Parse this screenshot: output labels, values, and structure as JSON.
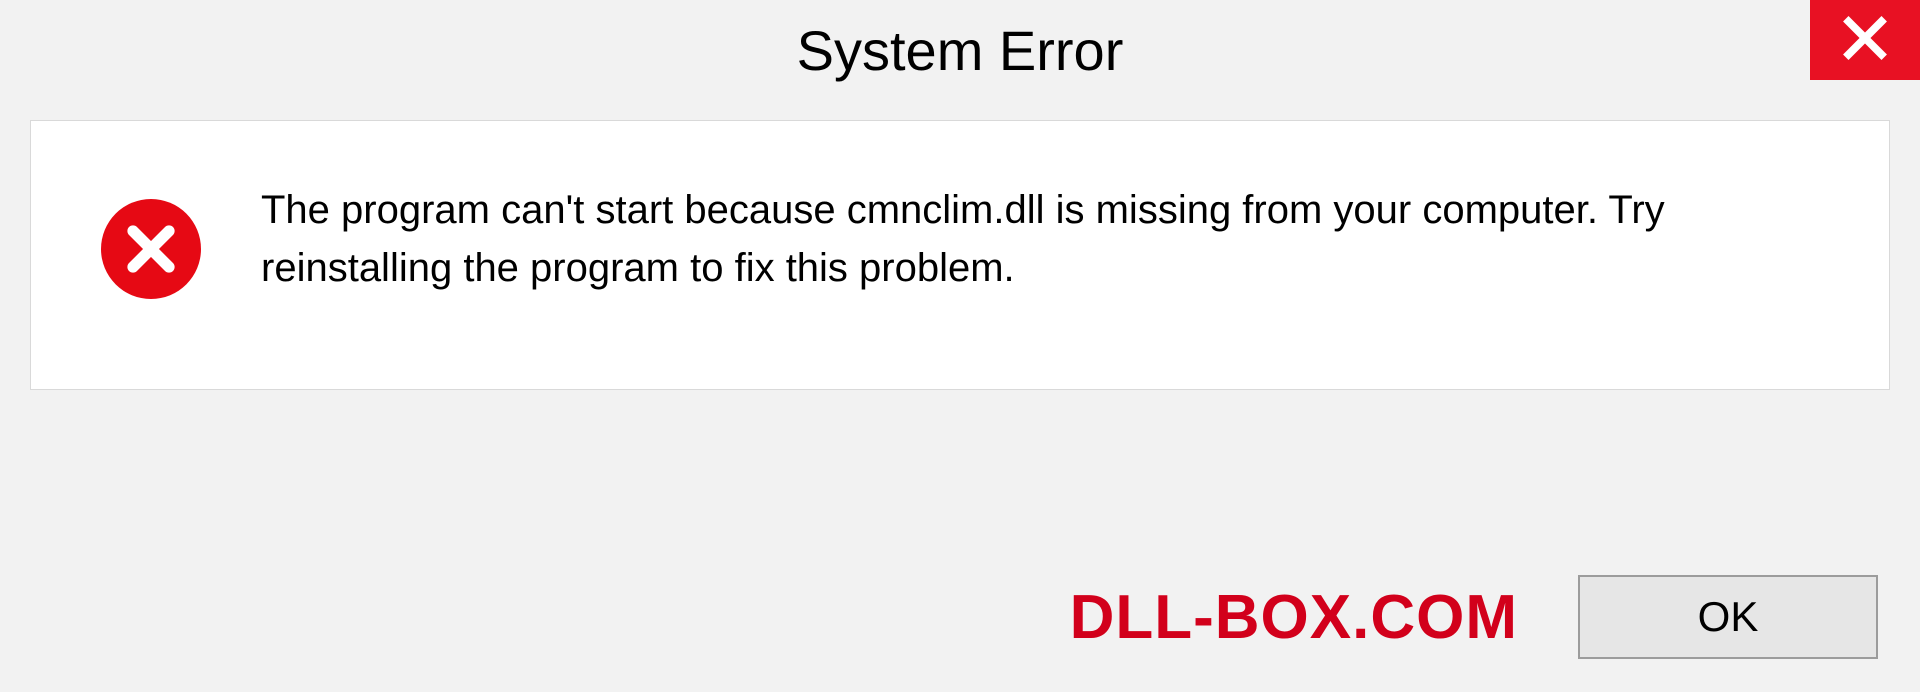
{
  "titlebar": {
    "title": "System Error",
    "close_icon": "close-icon"
  },
  "dialog": {
    "error_icon": "error-circle-x-icon",
    "message": "The program can't start because cmnclim.dll is missing from your computer. Try reinstalling the program to fix this problem."
  },
  "footer": {
    "watermark": "DLL-BOX.COM",
    "ok_label": "OK"
  },
  "colors": {
    "close_button_bg": "#e81123",
    "error_icon_bg": "#e60914",
    "watermark_color": "#d2001b",
    "panel_bg": "#ffffff",
    "body_bg": "#f2f2f2",
    "ok_bg": "#e6e6e6",
    "ok_border": "#9c9c9c"
  }
}
